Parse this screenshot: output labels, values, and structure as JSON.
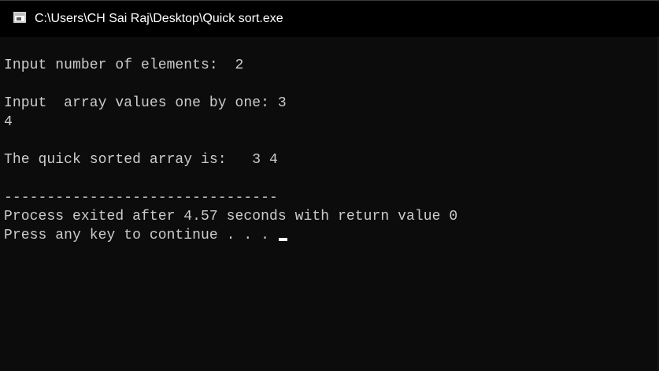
{
  "window": {
    "title": "C:\\Users\\CH Sai Raj\\Desktop\\Quick sort.exe",
    "icon": "console-app-icon"
  },
  "console": {
    "lines": [
      "Input number of elements:  2",
      "Input  array values one by one: 3",
      "4",
      "The quick sorted array is:   3 4",
      "--------------------------------",
      "Process exited after 4.57 seconds with return value 0",
      "Press any key to continue . . . "
    ]
  },
  "colors": {
    "background": "#0c0c0c",
    "titlebar": "#000000",
    "text": "#cccccc",
    "cursor": "#ffffff"
  }
}
